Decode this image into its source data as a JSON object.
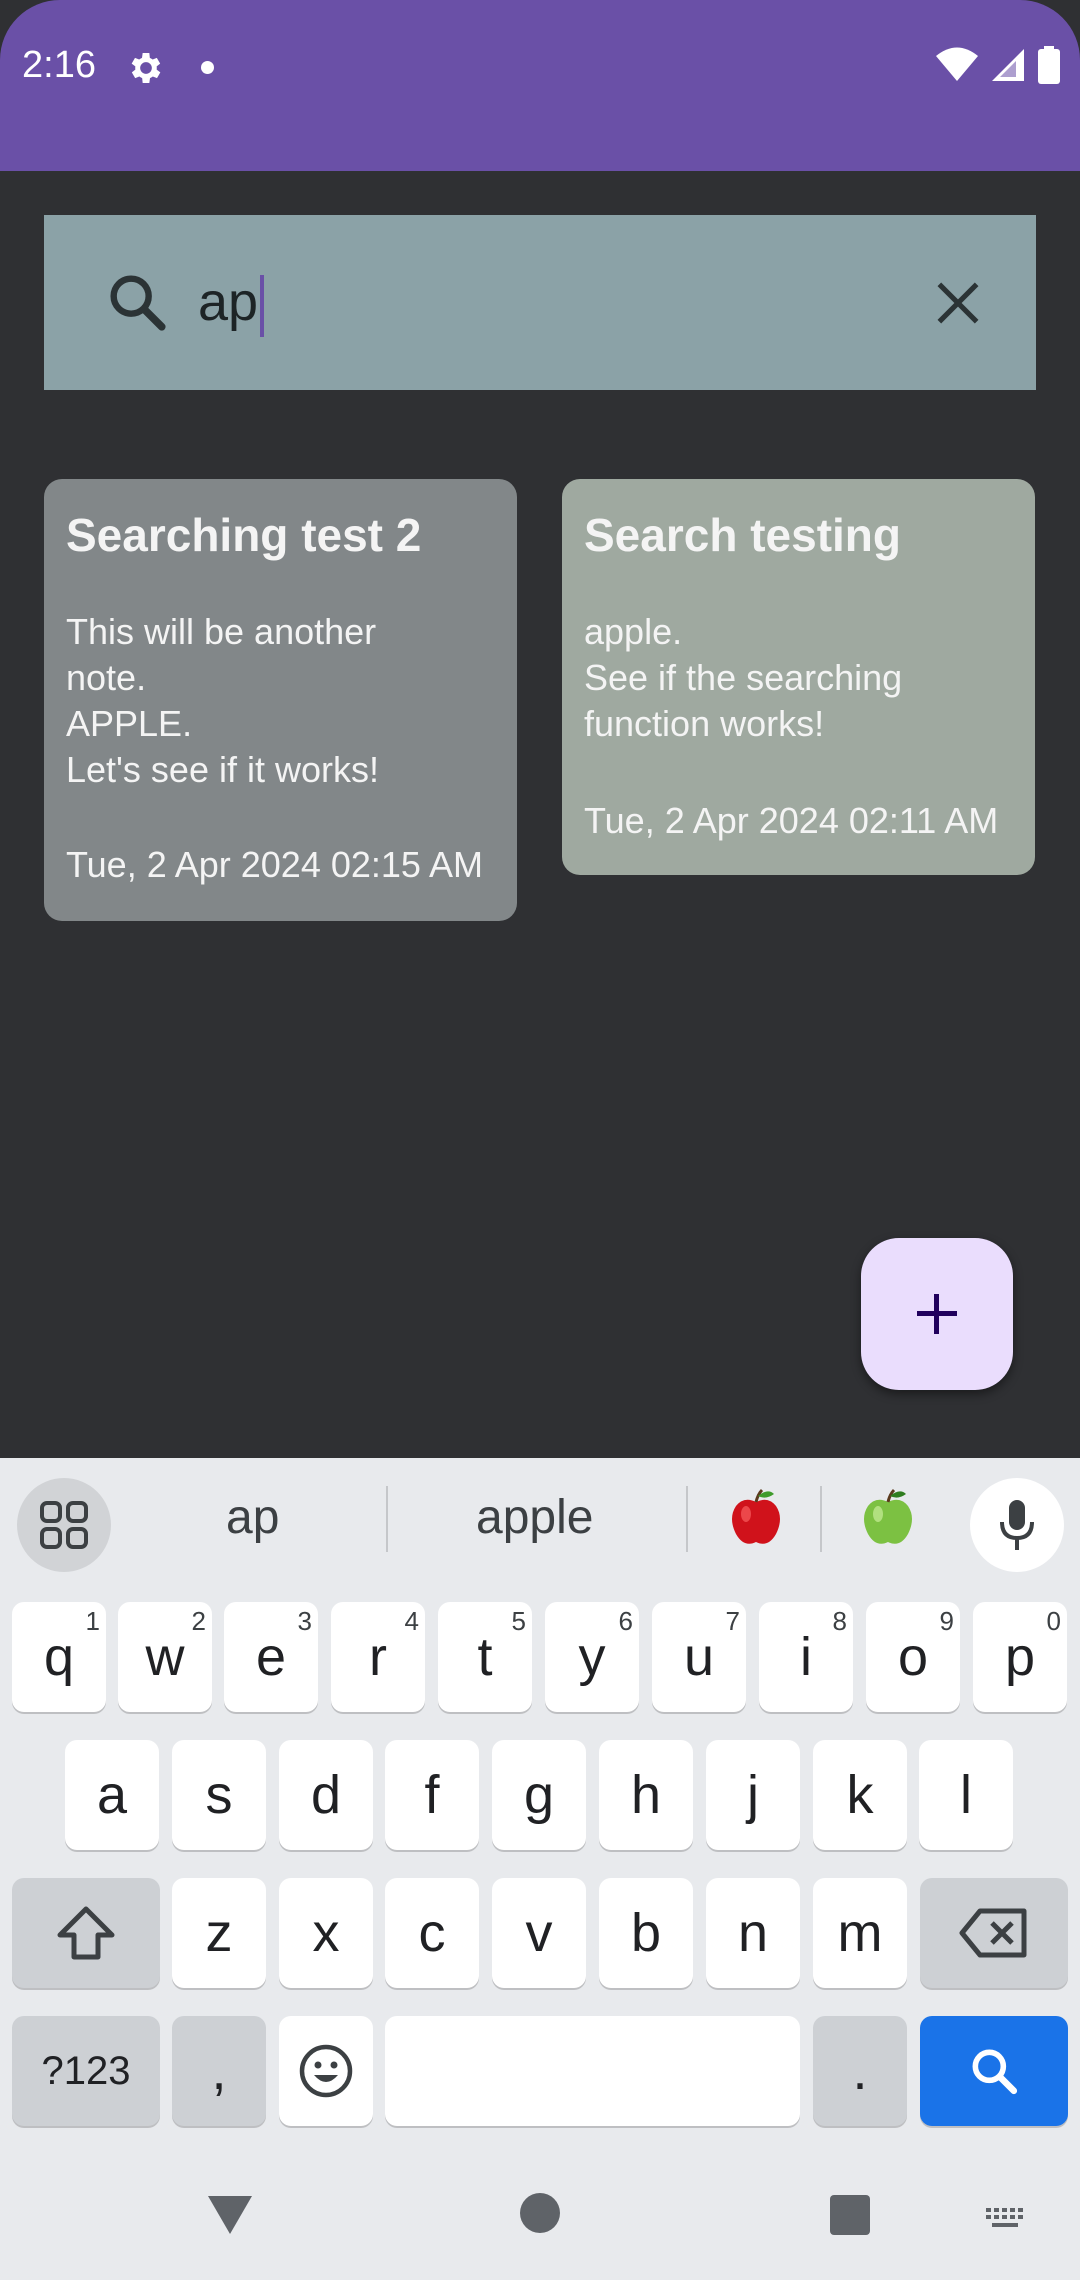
{
  "status_bar": {
    "time": "2:16"
  },
  "search": {
    "query": "ap"
  },
  "notes": [
    {
      "title": "Searching test 2",
      "body": "This will be another\nnote.\nAPPLE.\nLet's see if it works!",
      "date": "Tue, 2 Apr 2024 02:15 AM",
      "color": "#828789"
    },
    {
      "title": "Search testing",
      "body": "apple.\nSee if the searching\nfunction works!",
      "date": "Tue, 2 Apr 2024 02:11 AM",
      "color": "#9fa9a0"
    }
  ],
  "fab": {
    "icon": "plus-icon"
  },
  "keyboard": {
    "suggestions": [
      "ap",
      "apple"
    ],
    "emoji_suggestions": [
      "red-apple-icon",
      "green-apple-icon"
    ],
    "row1": [
      {
        "key": "q",
        "hint": "1"
      },
      {
        "key": "w",
        "hint": "2"
      },
      {
        "key": "e",
        "hint": "3"
      },
      {
        "key": "r",
        "hint": "4"
      },
      {
        "key": "t",
        "hint": "5"
      },
      {
        "key": "y",
        "hint": "6"
      },
      {
        "key": "u",
        "hint": "7"
      },
      {
        "key": "i",
        "hint": "8"
      },
      {
        "key": "o",
        "hint": "9"
      },
      {
        "key": "p",
        "hint": "0"
      }
    ],
    "row2": [
      "a",
      "s",
      "d",
      "f",
      "g",
      "h",
      "j",
      "k",
      "l"
    ],
    "row3": [
      "z",
      "x",
      "c",
      "v",
      "b",
      "n",
      "m"
    ],
    "symbols_label": "?123",
    "comma_label": ",",
    "period_label": "."
  },
  "colors": {
    "status_bar": "#6a50a7",
    "background": "#2f3033",
    "search_bar": "#8ba2a7",
    "fab": "#eaddfd",
    "keyboard": "#e8eaed",
    "action_key": "#1a73e8"
  }
}
